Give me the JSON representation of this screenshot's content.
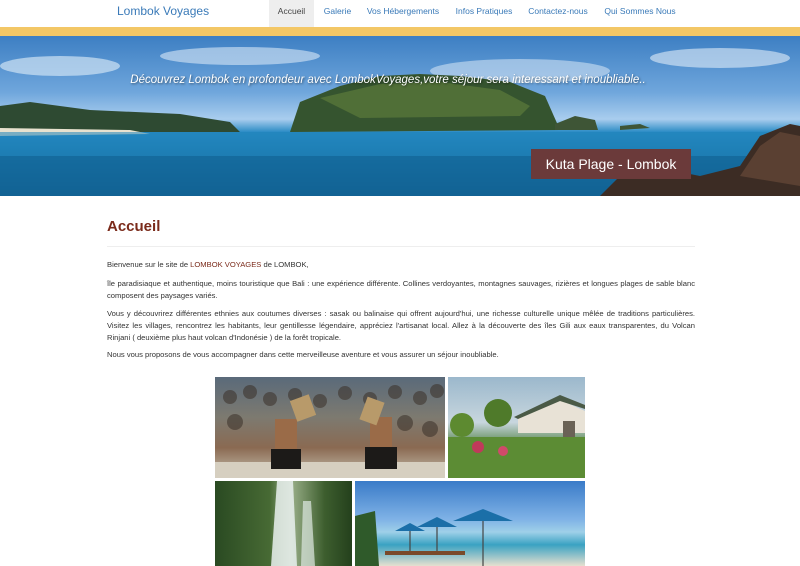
{
  "brand": "Lombok Voyages",
  "nav": {
    "items": [
      "Accueil",
      "Galerie",
      "Vos Hébergements",
      "Infos Pratiques",
      "Contactez-nous",
      "Qui Sommes Nous"
    ],
    "active": "Accueil"
  },
  "hero": {
    "subtitle": "Découvrez Lombok en profondeur avec LombokVoyages,votre séjour sera interessant et inoubliable..",
    "caption": "Kuta Plage - Lombok"
  },
  "page": {
    "title": "Accueil",
    "intro_prefix": "Bienvenue sur le site de ",
    "intro_highlight": "LOMBOK VOYAGES",
    "intro_suffix": " de LOMBOK,",
    "p1": "île paradisiaque et authentique, moins touristique que Bali : une expérience différente. Collines verdoyantes, montagnes sauvages, rizières et longues plages de sable blanc composent des paysages variés.",
    "p2": "Vous y découvrirez différentes ethnies aux coutumes diverses : sasak ou balinaise qui offrent aujourd'hui, une richesse culturelle unique mêlée de traditions particulières. Visitez les villages, rencontrez les habitants, leur gentillesse légendaire, appréciez l'artisanat local. Allez à la découverte des îles Gili aux eaux transparentes, du Volcan Rinjani ( deuxième plus haut volcan d'Indonésie ) de la forêt tropicale.",
    "p3": "Nous vous proposons de vous accompagner dans cette merveilleuse aventure et vous assurer un séjour inoubliable."
  },
  "colors": {
    "brand": "#3a7ab8",
    "title": "#7a2a1a",
    "yellow": "#f3c766",
    "caption_bg": "#6b3a3a"
  }
}
